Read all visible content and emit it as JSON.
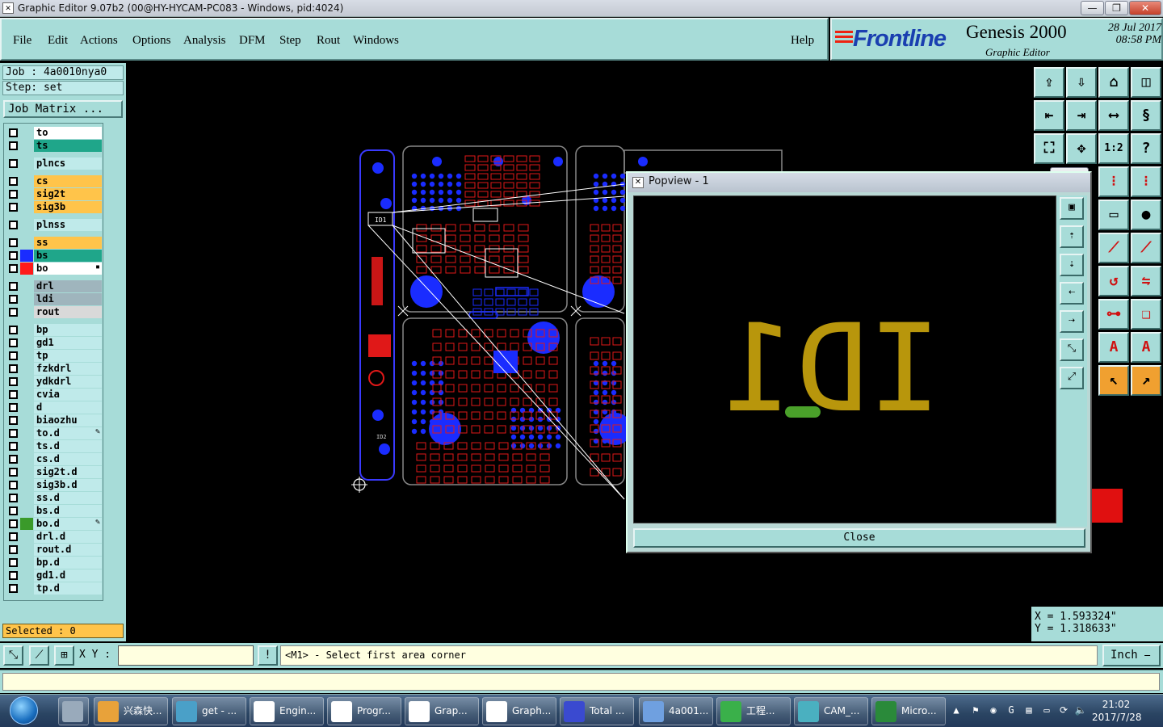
{
  "window": {
    "title": "Graphic Editor 9.07b2 (00@HY-HYCAM-PC083 - Windows, pid:4024)",
    "controls": [
      "—",
      "❐",
      "✕"
    ]
  },
  "menu": {
    "items": [
      "File",
      "Edit",
      "Actions",
      "Options",
      "Analysis",
      "DFM",
      "Step",
      "Rout",
      "Windows"
    ],
    "help": "Help"
  },
  "brand": {
    "logo": "Frontline",
    "product": "Genesis 2000",
    "subtitle": "Graphic Editor",
    "date": "28 Jul 2017",
    "time": "08:58 PM"
  },
  "job": {
    "job_label": "Job : 4a0010nya0",
    "step_label": "Step: set",
    "job_matrix": "Job Matrix ..."
  },
  "layers": [
    {
      "name": "to",
      "color": "#ffffff",
      "swatch": "",
      "mark": ""
    },
    {
      "name": "ts",
      "color": "#1fa68a",
      "swatch": "",
      "mark": ""
    },
    {
      "name": "plncs",
      "color": "#bfeaea",
      "swatch": "",
      "mark": ""
    },
    {
      "name": "cs",
      "color": "#ffc44a",
      "swatch": "",
      "mark": ""
    },
    {
      "name": "sig2t",
      "color": "#ffc44a",
      "swatch": "",
      "mark": ""
    },
    {
      "name": "sig3b",
      "color": "#ffc44a",
      "swatch": "",
      "mark": ""
    },
    {
      "name": "plnss",
      "color": "#bfeaea",
      "swatch": "",
      "mark": ""
    },
    {
      "name": "ss",
      "color": "#ffc44a",
      "swatch": "",
      "mark": ""
    },
    {
      "name": "bs",
      "color": "#1fa68a",
      "swatch": "#1a2cff",
      "mark": ""
    },
    {
      "name": "bo",
      "color": "#ffffff",
      "swatch": "#ff1a1a",
      "mark": "▪"
    },
    {
      "name": "drl",
      "color": "#9fb5bd",
      "swatch": "",
      "mark": ""
    },
    {
      "name": "ldi",
      "color": "#9fb5bd",
      "swatch": "",
      "mark": ""
    },
    {
      "name": "rout",
      "color": "#d9d9d9",
      "swatch": "",
      "mark": ""
    },
    {
      "name": "bp",
      "color": "#bfeaea",
      "swatch": "",
      "mark": ""
    },
    {
      "name": "gd1",
      "color": "#bfeaea",
      "swatch": "",
      "mark": ""
    },
    {
      "name": "tp",
      "color": "#bfeaea",
      "swatch": "",
      "mark": ""
    },
    {
      "name": "fzkdrl",
      "color": "#bfeaea",
      "swatch": "",
      "mark": ""
    },
    {
      "name": "ydkdrl",
      "color": "#bfeaea",
      "swatch": "",
      "mark": ""
    },
    {
      "name": "cvia",
      "color": "#bfeaea",
      "swatch": "",
      "mark": ""
    },
    {
      "name": "d",
      "color": "#bfeaea",
      "swatch": "",
      "mark": ""
    },
    {
      "name": "biaozhu",
      "color": "#bfeaea",
      "swatch": "",
      "mark": ""
    },
    {
      "name": "to.d",
      "color": "#bfeaea",
      "swatch": "",
      "mark": "✎"
    },
    {
      "name": "ts.d",
      "color": "#bfeaea",
      "swatch": "",
      "mark": ""
    },
    {
      "name": "cs.d",
      "color": "#bfeaea",
      "swatch": "",
      "mark": ""
    },
    {
      "name": "sig2t.d",
      "color": "#bfeaea",
      "swatch": "",
      "mark": ""
    },
    {
      "name": "sig3b.d",
      "color": "#bfeaea",
      "swatch": "",
      "mark": ""
    },
    {
      "name": "ss.d",
      "color": "#bfeaea",
      "swatch": "",
      "mark": ""
    },
    {
      "name": "bs.d",
      "color": "#bfeaea",
      "swatch": "",
      "mark": ""
    },
    {
      "name": "bo.d",
      "color": "#bfeaea",
      "swatch": "#3a9a2a",
      "mark": "✎"
    },
    {
      "name": "drl.d",
      "color": "#bfeaea",
      "swatch": "",
      "mark": ""
    },
    {
      "name": "rout.d",
      "color": "#bfeaea",
      "swatch": "",
      "mark": ""
    },
    {
      "name": "bp.d",
      "color": "#bfeaea",
      "swatch": "",
      "mark": ""
    },
    {
      "name": "gd1.d",
      "color": "#bfeaea",
      "swatch": "",
      "mark": ""
    },
    {
      "name": "tp.d",
      "color": "#bfeaea",
      "swatch": "",
      "mark": ""
    }
  ],
  "selected": "Selected : 0",
  "coords": {
    "x": "X = 1.593324\"",
    "y": "Y = 1.318633\""
  },
  "command": {
    "xy_label": "X Y :",
    "xy_value": "",
    "prompt": "<M1> - Select first area corner",
    "unit": "Inch ⎯"
  },
  "popview": {
    "title": "Popview - 1",
    "text": "ID1",
    "close": "Close",
    "close_x": "✕"
  },
  "canvas": {
    "id_label_small": "ID1",
    "id_label_small2": "ID2"
  },
  "taskbar": {
    "items": [
      {
        "label": "兴森快...",
        "icon_color": "#e8a23a"
      },
      {
        "label": "get - ...",
        "icon_color": "#4aa0c8"
      },
      {
        "label": "Engin...",
        "icon_color": "#ffffff"
      },
      {
        "label": "Progr...",
        "icon_color": "#ffffff"
      },
      {
        "label": "Grap...",
        "icon_color": "#ffffff"
      },
      {
        "label": "Graph...",
        "icon_color": "#ffffff"
      },
      {
        "label": "Total ...",
        "icon_color": "#3a4ad0"
      },
      {
        "label": "4a001...",
        "icon_color": "#6fa0e0"
      },
      {
        "label": "工程...",
        "icon_color": "#3ab04a"
      },
      {
        "label": "CAM_...",
        "icon_color": "#4ab0c0"
      },
      {
        "label": "Micro...",
        "icon_color": "#2a8a3a"
      }
    ],
    "time": "21:02",
    "date": "2017/7/28"
  },
  "colors": {
    "panel": "#a7dcd8",
    "pcb_blue": "#1a2cff",
    "pcb_red": "#e01818",
    "gold": "#b8960c",
    "green": "#4aa02a"
  }
}
